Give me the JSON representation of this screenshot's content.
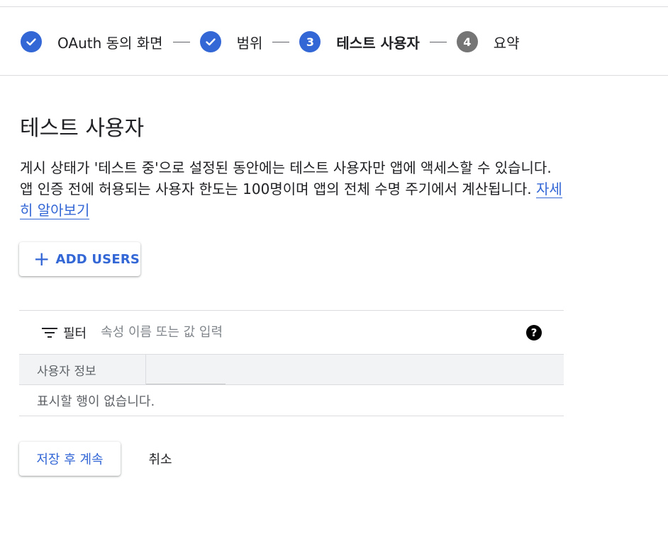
{
  "stepper": {
    "steps": [
      {
        "label": "OAuth 동의 화면",
        "state": "done",
        "number": ""
      },
      {
        "label": "범위",
        "state": "done",
        "number": ""
      },
      {
        "label": "테스트 사용자",
        "state": "active",
        "number": "3"
      },
      {
        "label": "요약",
        "state": "pending",
        "number": "4"
      }
    ]
  },
  "page": {
    "title": "테스트 사용자",
    "description": "게시 상태가 '테스트 중'으로 설정된 동안에는 테스트 사용자만 앱에 액세스할 수 있습니다. 앱 인증 전에 허용되는 사용자 한도는 100명이며 앱의 전체 수명 주기에서 계산됩니다. ",
    "learn_more": "자세히 알아보기"
  },
  "add_users": {
    "icon": "plus-icon",
    "label": "ADD USERS"
  },
  "filter": {
    "icon": "filter-icon",
    "label": "필터",
    "placeholder": "속성 이름 또는 값 입력",
    "help_icon": "help-icon"
  },
  "table": {
    "columns": [
      "사용자 정보",
      ""
    ],
    "empty_message": "표시할 행이 없습니다."
  },
  "actions": {
    "save": "저장 후 계속",
    "cancel": "취소"
  },
  "colors": {
    "accent": "#3367d6",
    "pending": "#757575"
  }
}
